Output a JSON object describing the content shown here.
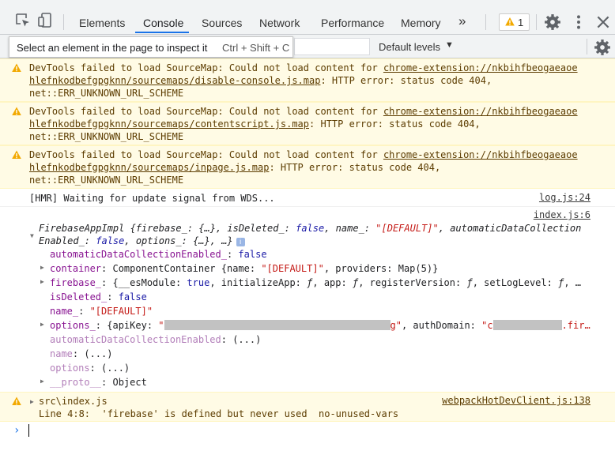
{
  "tabs": {
    "elements": "Elements",
    "console": "Console",
    "sources": "Sources",
    "network": "Network",
    "performance": "Performance",
    "memory": "Memory",
    "more": "»"
  },
  "warnings_badge": {
    "count": "1"
  },
  "toolbar": {
    "levels": "Default levels",
    "levels_arrow": "▼"
  },
  "tooltip": {
    "text": "Select an element in the page to inspect it",
    "shortcut": "Ctrl + Shift + C"
  },
  "messages": {
    "w1": {
      "l1_pre": "DevTools failed to load SourceMap: Could not load content for ",
      "l1_link": "chrome-extension://nkbihfbeogaeaoe",
      "l2_link": "hlefnkodbefgpgknn/sourcemaps/disable-console.js.map",
      "l2_post": ": HTTP error: status code 404,",
      "l3": "net::ERR_UNKNOWN_URL_SCHEME"
    },
    "w2": {
      "l1_pre": "DevTools failed to load SourceMap: Could not load content for ",
      "l1_link": "chrome-extension://nkbihfbeogaeaoe",
      "l2_link": "hlefnkodbefgpgknn/sourcemaps/contentscript.js.map",
      "l2_post": ": HTTP error: status code 404,",
      "l3": "net::ERR_UNKNOWN_URL_SCHEME"
    },
    "w3": {
      "l1_pre": "DevTools failed to load SourceMap: Could not load content for ",
      "l1_link": "chrome-extension://nkbihfbeogaeaoe",
      "l2_link": "hlefnkodbefgpgknn/sourcemaps/inpage.js.map",
      "l2_post": ": HTTP error: status code 404,",
      "l3": "net::ERR_UNKNOWN_URL_SCHEME"
    },
    "hmr": {
      "text": "[HMR] Waiting for update signal from WDS...",
      "source": "log.js:24"
    },
    "obj": {
      "source": "index.js:6",
      "sum_name": "FirebaseAppImpl ",
      "s1": "{firebase_: {…}, isDeleted_: ",
      "s1_false": "false",
      "s1_b": ", name_: ",
      "s1_str": "\"[DEFAULT]\"",
      "s1_c": ", automaticDataCollection",
      "s2": "Enabled_: ",
      "s2_false": "false",
      "s2_b": ", options_: {…}, …}",
      "p1_key": "automaticDataCollectionEnabled_",
      "p1_val": "false",
      "p2_key": "container",
      "p2_a": "ComponentContainer {name: ",
      "p2_str": "\"[DEFAULT]\"",
      "p2_b": ", providers: Map(5)}",
      "p3_key": "firebase_",
      "p3_a": "{__esModule: ",
      "p3_true": "true",
      "p3_b": ", initializeApp: ",
      "p3_f1": "ƒ",
      "p3_c": ", app: ",
      "p3_f2": "ƒ",
      "p3_d": ", registerVersion: ",
      "p3_f3": "ƒ",
      "p3_e": ", setLogLevel: ",
      "p3_f4": "ƒ",
      "p3_g": ", …",
      "p4_key": "isDeleted_",
      "p4_val": "false",
      "p5_key": "name_",
      "p5_val": "\"[DEFAULT]\"",
      "p6_key": "options_",
      "p6_a": "{apiKey: ",
      "p6_q1": "\"",
      "p6_tail": "g\"",
      "p6_b": ", authDomain: ",
      "p6_q2": "\"c",
      "p6_tail2": ".fir…",
      "p7_key": "automaticDataCollectionEnabled",
      "p7_val": "(...)",
      "p8_key": "name",
      "p8_val": "(...)",
      "p9_key": "options",
      "p9_val": "(...)",
      "p10_key": "__proto__",
      "p10_val": "Object"
    },
    "w4": {
      "file": "src\\index.js",
      "source": "webpackHotDevClient.js:138",
      "detail": "Line 4:8:  'firebase' is defined but never used  no-unused-vars"
    }
  }
}
